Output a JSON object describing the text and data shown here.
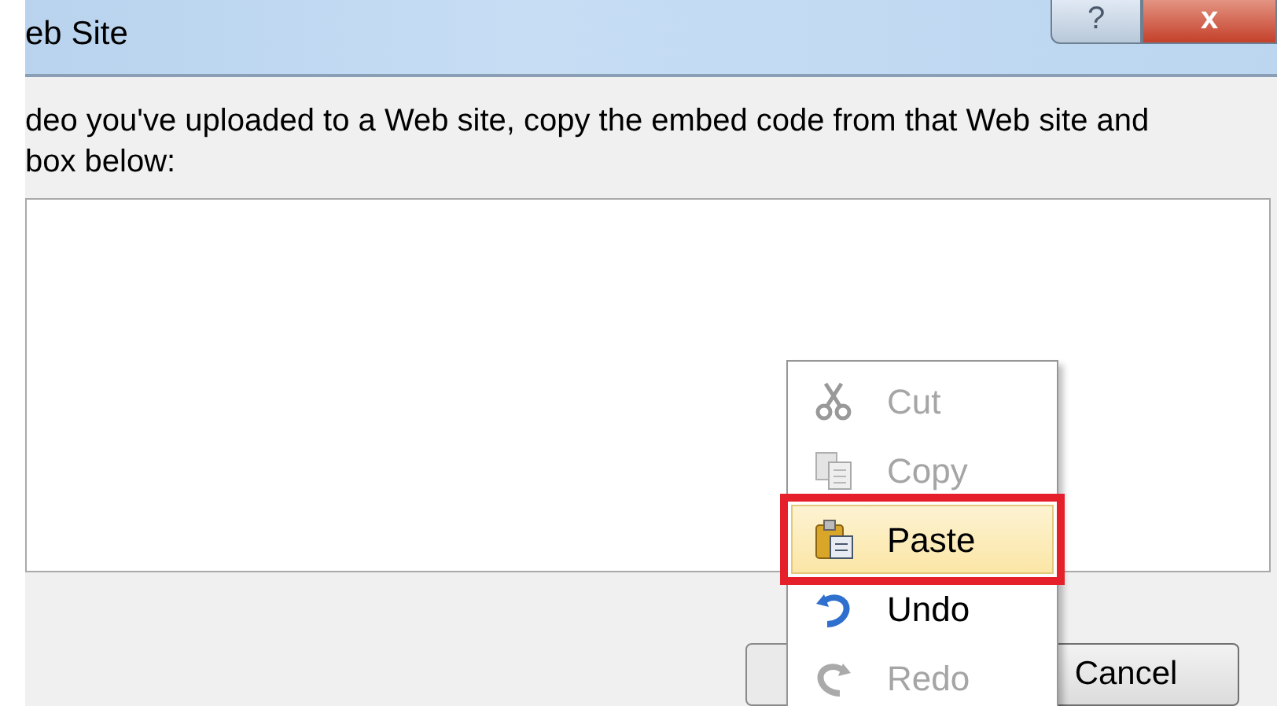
{
  "window": {
    "title": "eb Site",
    "buttons": [
      {
        "kind": "help",
        "label": "?"
      },
      {
        "kind": "close",
        "label": "x"
      }
    ]
  },
  "instructions": [
    "deo you've uploaded to a Web site, copy the embed code from that Web site and",
    "box below:"
  ],
  "buttons": [
    {
      "label": "Cancel"
    }
  ],
  "context_menu": {
    "items": [
      {
        "kind": "cut",
        "label": "Cut",
        "disabled": true,
        "selected": false,
        "highlighted": false
      },
      {
        "kind": "copy",
        "label": "Copy",
        "disabled": true,
        "selected": false,
        "highlighted": false
      },
      {
        "kind": "paste",
        "label": "Paste",
        "disabled": false,
        "selected": true,
        "highlighted": true
      },
      {
        "kind": "undo",
        "label": "Undo",
        "disabled": false,
        "selected": false,
        "highlighted": false
      },
      {
        "kind": "redo",
        "label": "Redo",
        "disabled": true,
        "selected": false,
        "highlighted": false
      }
    ]
  }
}
